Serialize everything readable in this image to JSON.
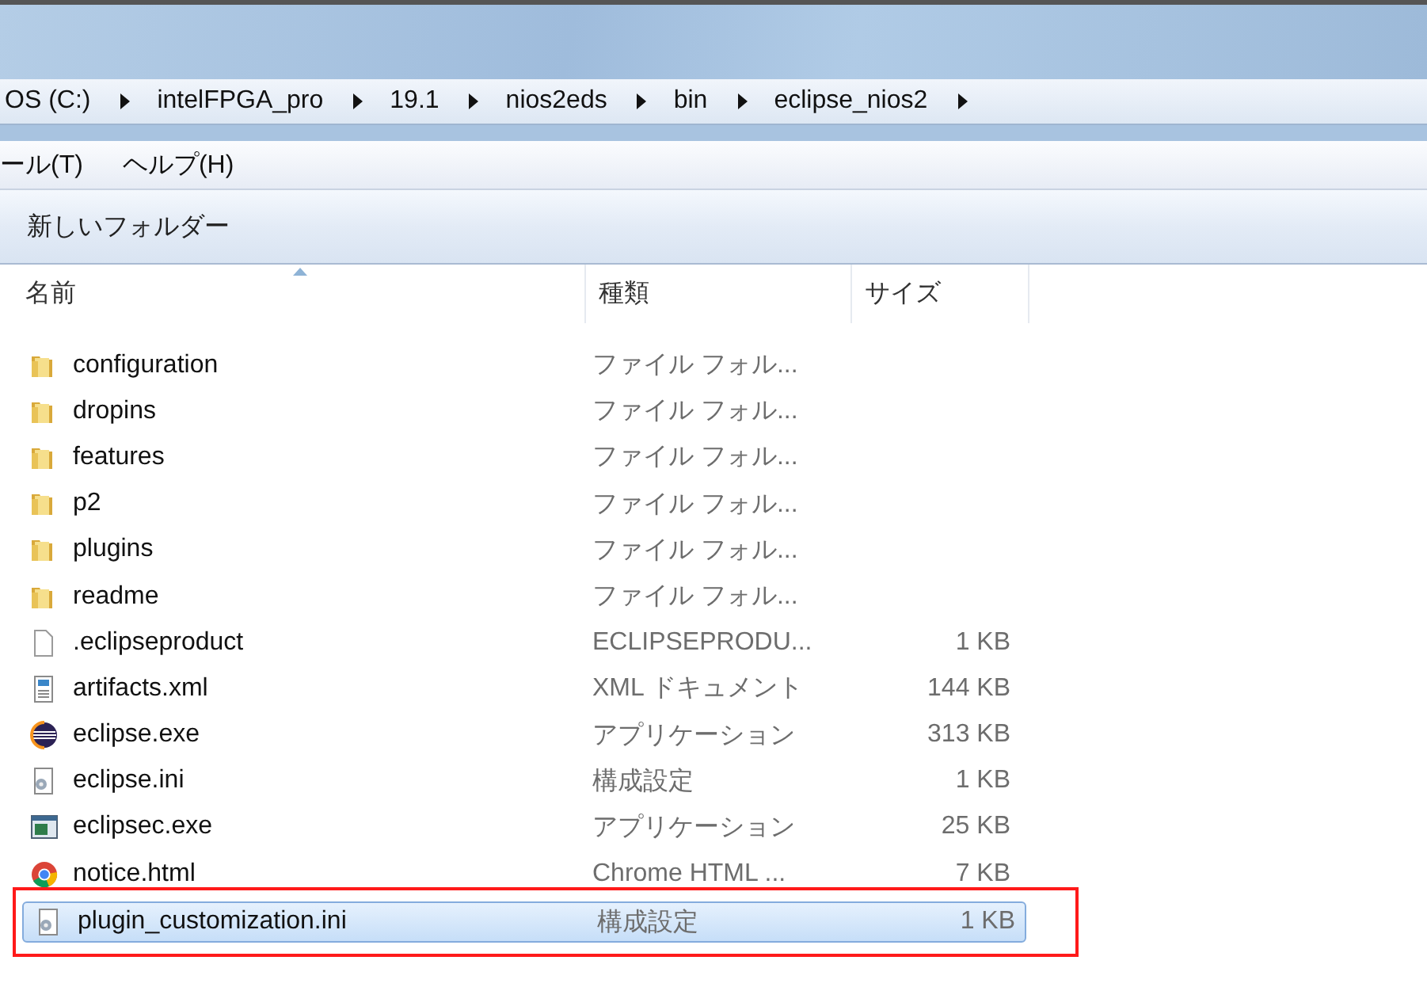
{
  "address_bar": {
    "segments": [
      "OS (C:)",
      "intelFPGA_pro",
      "19.1",
      "nios2eds",
      "bin",
      "eclipse_nios2"
    ]
  },
  "menu_bar": {
    "items": [
      "ール(T)",
      "ヘルプ(H)"
    ]
  },
  "toolbar": {
    "buttons": [
      "新しいフォルダー"
    ]
  },
  "file_list": {
    "columns": [
      {
        "label": "名前",
        "sorted": true
      },
      {
        "label": "種類",
        "sorted": false
      },
      {
        "label": "サイズ",
        "sorted": false
      }
    ],
    "rows": [
      {
        "kind": "folder",
        "name": "configuration",
        "type": "ファイル フォル...",
        "size": "",
        "selected": false,
        "outlined": false
      },
      {
        "kind": "folder",
        "name": "dropins",
        "type": "ファイル フォル...",
        "size": "",
        "selected": false,
        "outlined": false
      },
      {
        "kind": "folder",
        "name": "features",
        "type": "ファイル フォル...",
        "size": "",
        "selected": false,
        "outlined": false
      },
      {
        "kind": "folder",
        "name": "p2",
        "type": "ファイル フォル...",
        "size": "",
        "selected": false,
        "outlined": false
      },
      {
        "kind": "folder",
        "name": "plugins",
        "type": "ファイル フォル...",
        "size": "",
        "selected": false,
        "outlined": false
      },
      {
        "kind": "folder",
        "name": "readme",
        "type": "ファイル フォル...",
        "size": "",
        "selected": false,
        "outlined": false
      },
      {
        "kind": "blank",
        "name": ".eclipseproduct",
        "type": "ECLIPSEPRODU...",
        "size": "1 KB",
        "selected": false,
        "outlined": false
      },
      {
        "kind": "xml",
        "name": "artifacts.xml",
        "type": "XML ドキュメント",
        "size": "144 KB",
        "selected": false,
        "outlined": false
      },
      {
        "kind": "eclipse",
        "name": "eclipse.exe",
        "type": "アプリケーション",
        "size": "313 KB",
        "selected": false,
        "outlined": false
      },
      {
        "kind": "ini",
        "name": "eclipse.ini",
        "type": "構成設定",
        "size": "1 KB",
        "selected": false,
        "outlined": false
      },
      {
        "kind": "exe",
        "name": "eclipsec.exe",
        "type": "アプリケーション",
        "size": "25 KB",
        "selected": false,
        "outlined": false
      },
      {
        "kind": "chrome",
        "name": "notice.html",
        "type": "Chrome HTML ...",
        "size": "7 KB",
        "selected": false,
        "outlined": false
      },
      {
        "kind": "ini",
        "name": "plugin_customization.ini",
        "type": "構成設定",
        "size": "1 KB",
        "selected": true,
        "outlined": true
      }
    ]
  }
}
